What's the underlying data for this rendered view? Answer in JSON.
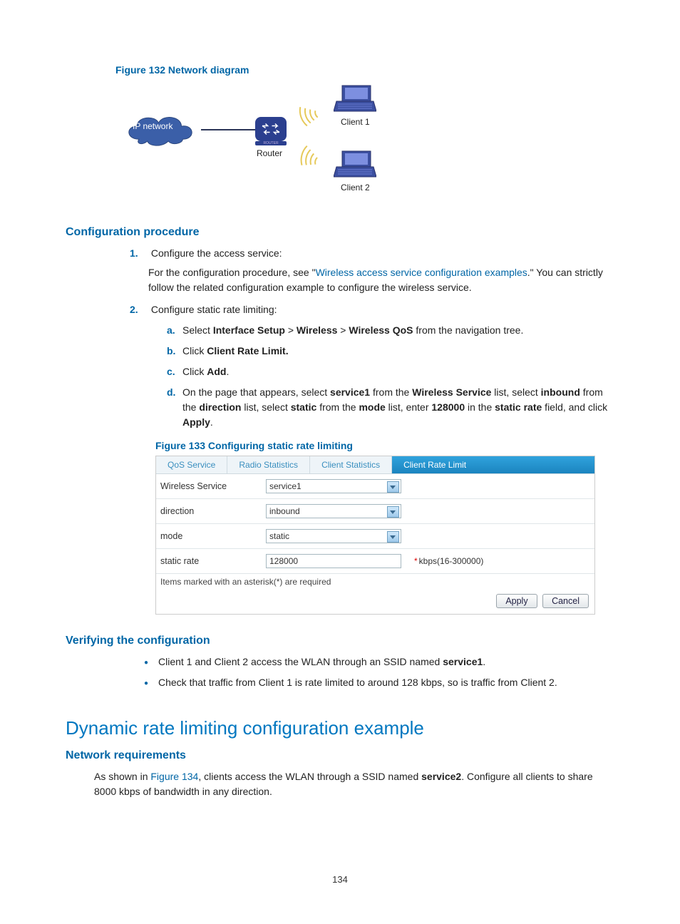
{
  "figure132_caption": "Figure 132 Network diagram",
  "diagram": {
    "cloud_label": "IP network",
    "router_label": "Router",
    "router_strip": "ROUTER",
    "client1_label": "Client 1",
    "client2_label": "Client 2"
  },
  "section_config_procedure": "Configuration procedure",
  "steps": {
    "s1_num": "1.",
    "s1_text": "Configure the access service:",
    "s1_sub_prefix": "For the configuration procedure, see \"",
    "s1_sub_link": "Wireless access service configuration examples",
    "s1_sub_suffix": ".\" You can strictly follow the related configuration example to configure the wireless service.",
    "s2_num": "2.",
    "s2_text": "Configure static rate limiting:",
    "a_label": "a.",
    "a_pre": "Select ",
    "a_b1": "Interface Setup",
    "a_gt1": " > ",
    "a_b2": "Wireless",
    "a_gt2": " > ",
    "a_b3": "Wireless QoS",
    "a_post": " from the navigation tree.",
    "b_label": "b.",
    "b_pre": "Click ",
    "b_b1": "Client Rate Limit.",
    "c_label": "c.",
    "c_pre": "Click ",
    "c_b1": "Add",
    "c_post": ".",
    "d_label": "d.",
    "d_p1": "On the page that appears, select ",
    "d_b1": "service1",
    "d_p2": " from the ",
    "d_b2": "Wireless Service",
    "d_p3": " list, select ",
    "d_b3": "inbound",
    "d_p4": " from the ",
    "d_b4": "direction",
    "d_p5": " list, select ",
    "d_b5": "static",
    "d_p6": " from the ",
    "d_b6": "mode",
    "d_p7": " list, enter ",
    "d_b7": "128000",
    "d_p8": " in the ",
    "d_b8": "static rate",
    "d_p9": " field, and click ",
    "d_b9": "Apply",
    "d_p10": "."
  },
  "figure133_caption": "Figure 133 Configuring static rate limiting",
  "cfg": {
    "tabs": {
      "qos": "QoS Service",
      "radio": "Radio Statistics",
      "client": "Client Statistics",
      "rate": "Client Rate Limit"
    },
    "rows": {
      "service_label": "Wireless Service",
      "service_value": "service1",
      "dir_label": "direction",
      "dir_value": "inbound",
      "mode_label": "mode",
      "mode_value": "static",
      "rate_label": "static rate",
      "rate_value": "128000",
      "rate_unit": "kbps(16-300000)"
    },
    "required_note": "Items marked with an asterisk(*) are required",
    "apply": "Apply",
    "cancel": "Cancel"
  },
  "section_verify": "Verifying the configuration",
  "verify": {
    "b1_pre": "Client 1 and Client 2 access the WLAN through an SSID named ",
    "b1_b": "service1",
    "b1_post": ".",
    "b2": "Check that traffic from Client 1 is rate limited to around 128 kbps, so is traffic from Client 2."
  },
  "heading_dynamic": "Dynamic rate limiting configuration example",
  "section_netreq": "Network requirements",
  "netreq": {
    "pre": "As shown in ",
    "link": "Figure 134",
    "mid": ", clients access the WLAN through a SSID named ",
    "bold": "service2",
    "post": ". Configure all clients to share 8000 kbps of bandwidth in any direction."
  },
  "page_number": "134"
}
